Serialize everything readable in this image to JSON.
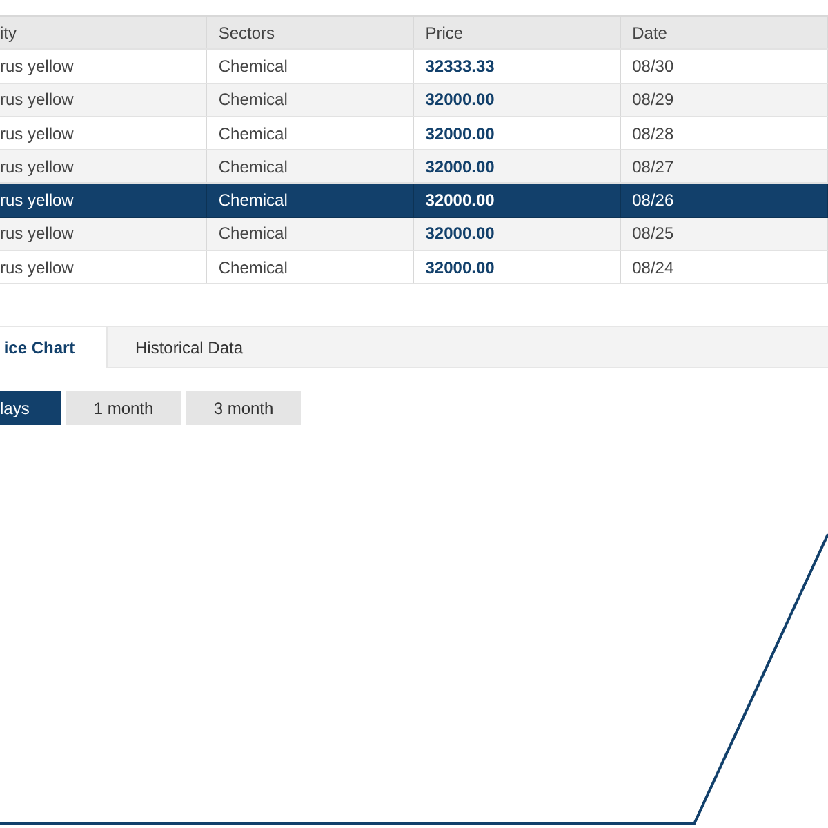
{
  "table": {
    "columns": [
      "ity",
      "Sectors",
      "Price",
      "Date"
    ],
    "rows": [
      {
        "cells": [
          "rus yellow",
          "Chemical",
          "32333.33",
          "08/30"
        ],
        "selected": false
      },
      {
        "cells": [
          "rus yellow",
          "Chemical",
          "32000.00",
          "08/29"
        ],
        "selected": false
      },
      {
        "cells": [
          "rus yellow",
          "Chemical",
          "32000.00",
          "08/28"
        ],
        "selected": false
      },
      {
        "cells": [
          "rus yellow",
          "Chemical",
          "32000.00",
          "08/27"
        ],
        "selected": false
      },
      {
        "cells": [
          "rus yellow",
          "Chemical",
          "32000.00",
          "08/26"
        ],
        "selected": true
      },
      {
        "cells": [
          "rus yellow",
          "Chemical",
          "32000.00",
          "08/25"
        ],
        "selected": false
      },
      {
        "cells": [
          "rus yellow",
          "Chemical",
          "32000.00",
          "08/24"
        ],
        "selected": false
      }
    ]
  },
  "tabs": [
    {
      "label": "ice Chart",
      "selected": true
    },
    {
      "label": "Historical Data",
      "selected": false
    }
  ],
  "ranges": [
    {
      "label": "lays",
      "selected": true
    },
    {
      "label": "1 month",
      "selected": false
    },
    {
      "label": "3 month",
      "selected": false
    }
  ]
}
